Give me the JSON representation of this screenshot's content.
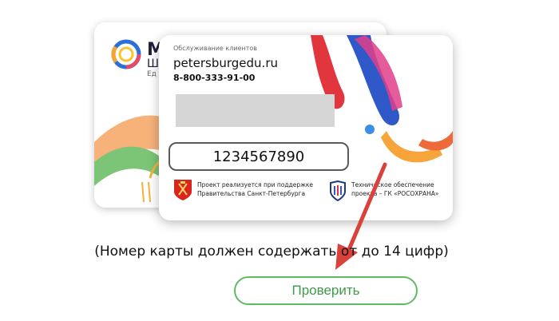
{
  "back_card": {
    "logo_line1": "М",
    "logo_line2": "Ш",
    "logo_line3": "Ед"
  },
  "front_card": {
    "service_label": "Обслуживание клиентов",
    "site": "petersburgedu.ru",
    "phone": "8-800-333-91-00",
    "card_number": "1234567890",
    "support_text_1": "Проект реализуется при поддержке",
    "support_text_2": "Правительства Санкт-Петербурга",
    "tech_text_1": "Техническое обеспечение",
    "tech_text_2": "проекта – ГК «РОСОХРАНА»"
  },
  "hint": "(Номер карты должен содержать от      до 14 цифр)",
  "check_button": "Проверить",
  "colors": {
    "accent_red": "#d9423a",
    "button_green": "#5fba6a",
    "button_text": "#3f9a4b"
  }
}
